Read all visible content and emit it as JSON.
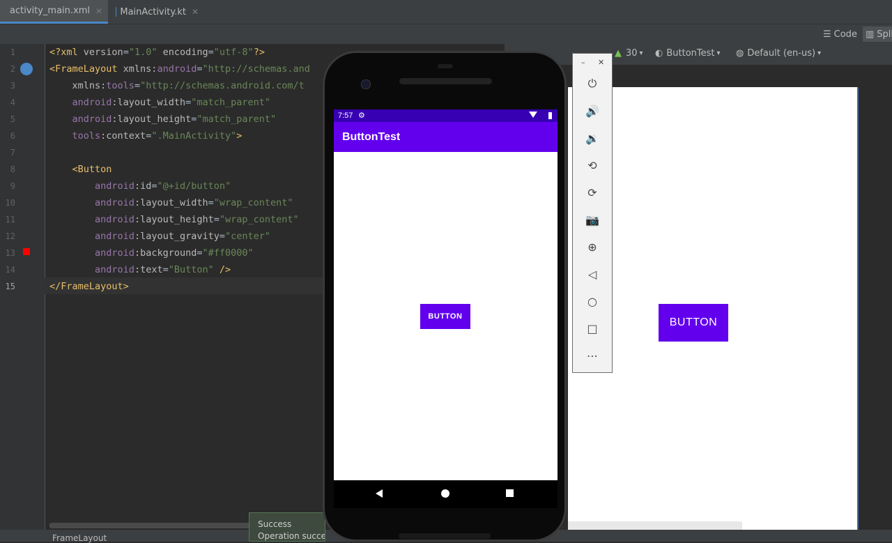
{
  "tabs": [
    {
      "label": "activity_main.xml",
      "active": true
    },
    {
      "label": "MainActivity.kt",
      "active": false
    }
  ],
  "view_modes": {
    "code": "Code",
    "split": "Split"
  },
  "design_toolbar": {
    "api": "30",
    "theme": "ButtonTest",
    "locale": "Default (en-us)"
  },
  "editor": {
    "line_numbers": [
      "1",
      "2",
      "3",
      "4",
      "5",
      "6",
      "7",
      "8",
      "9",
      "10",
      "11",
      "12",
      "13",
      "14",
      "15"
    ],
    "current_line": "15",
    "lines": [
      [
        {
          "t": "tag",
          "v": "<?xml "
        },
        {
          "t": "attr",
          "v": "version"
        },
        {
          "t": "plain",
          "v": "="
        },
        {
          "t": "str",
          "v": "\"1.0\""
        },
        {
          "t": "plain",
          "v": " "
        },
        {
          "t": "attr",
          "v": "encoding"
        },
        {
          "t": "plain",
          "v": "="
        },
        {
          "t": "str",
          "v": "\"utf-8\""
        },
        {
          "t": "tag",
          "v": "?>"
        }
      ],
      [
        {
          "t": "tag",
          "v": "<FrameLayout "
        },
        {
          "t": "attr",
          "v": "xmlns:"
        },
        {
          "t": "ns",
          "v": "android"
        },
        {
          "t": "plain",
          "v": "="
        },
        {
          "t": "str",
          "v": "\"http://schemas.and"
        }
      ],
      [
        {
          "t": "plain",
          "v": "    "
        },
        {
          "t": "attr",
          "v": "xmlns:"
        },
        {
          "t": "ns",
          "v": "tools"
        },
        {
          "t": "plain",
          "v": "="
        },
        {
          "t": "str",
          "v": "\"http://schemas.android.com/t"
        }
      ],
      [
        {
          "t": "plain",
          "v": "    "
        },
        {
          "t": "ns",
          "v": "android"
        },
        {
          "t": "attr",
          "v": ":layout_width"
        },
        {
          "t": "plain",
          "v": "="
        },
        {
          "t": "str",
          "v": "\"match_parent\""
        }
      ],
      [
        {
          "t": "plain",
          "v": "    "
        },
        {
          "t": "ns",
          "v": "android"
        },
        {
          "t": "attr",
          "v": ":layout_height"
        },
        {
          "t": "plain",
          "v": "="
        },
        {
          "t": "str",
          "v": "\"match_parent\""
        }
      ],
      [
        {
          "t": "plain",
          "v": "    "
        },
        {
          "t": "ns",
          "v": "tools"
        },
        {
          "t": "attr",
          "v": ":context"
        },
        {
          "t": "plain",
          "v": "="
        },
        {
          "t": "str",
          "v": "\".MainActivity\""
        },
        {
          "t": "tag",
          "v": ">"
        }
      ],
      [],
      [
        {
          "t": "plain",
          "v": "    "
        },
        {
          "t": "tag",
          "v": "<Button"
        }
      ],
      [
        {
          "t": "plain",
          "v": "        "
        },
        {
          "t": "ns",
          "v": "android"
        },
        {
          "t": "attr",
          "v": ":id"
        },
        {
          "t": "plain",
          "v": "="
        },
        {
          "t": "str",
          "v": "\"@+id/button\""
        }
      ],
      [
        {
          "t": "plain",
          "v": "        "
        },
        {
          "t": "ns",
          "v": "android"
        },
        {
          "t": "attr",
          "v": ":layout_width"
        },
        {
          "t": "plain",
          "v": "="
        },
        {
          "t": "str",
          "v": "\"wrap_content\""
        }
      ],
      [
        {
          "t": "plain",
          "v": "        "
        },
        {
          "t": "ns",
          "v": "android"
        },
        {
          "t": "attr",
          "v": ":layout_height"
        },
        {
          "t": "plain",
          "v": "="
        },
        {
          "t": "str",
          "v": "\"wrap_content\""
        }
      ],
      [
        {
          "t": "plain",
          "v": "        "
        },
        {
          "t": "ns",
          "v": "android"
        },
        {
          "t": "attr",
          "v": ":layout_gravity"
        },
        {
          "t": "plain",
          "v": "="
        },
        {
          "t": "str",
          "v": "\"center\""
        }
      ],
      [
        {
          "t": "plain",
          "v": "        "
        },
        {
          "t": "ns",
          "v": "android"
        },
        {
          "t": "attr",
          "v": ":background"
        },
        {
          "t": "plain",
          "v": "="
        },
        {
          "t": "str",
          "v": "\"#ff0000\""
        }
      ],
      [
        {
          "t": "plain",
          "v": "        "
        },
        {
          "t": "ns",
          "v": "android"
        },
        {
          "t": "attr",
          "v": ":text"
        },
        {
          "t": "plain",
          "v": "="
        },
        {
          "t": "str",
          "v": "\"Button\""
        },
        {
          "t": "plain",
          "v": " "
        },
        {
          "t": "tag",
          "v": "/>"
        }
      ],
      [
        {
          "t": "tag",
          "v": "</FrameLayout>"
        }
      ]
    ]
  },
  "phone": {
    "time": "7:57",
    "app_title": "ButtonTest",
    "button_label": "BUTTON"
  },
  "preview": {
    "button_label": "BUTTON"
  },
  "toast": {
    "title": "Success",
    "message": "Operation succe"
  },
  "status": {
    "breadcrumb": "FrameLayout"
  },
  "colors": {
    "accent": "#6200ee",
    "status_bar": "#3700b3",
    "breakpoint": "#ff0000"
  }
}
